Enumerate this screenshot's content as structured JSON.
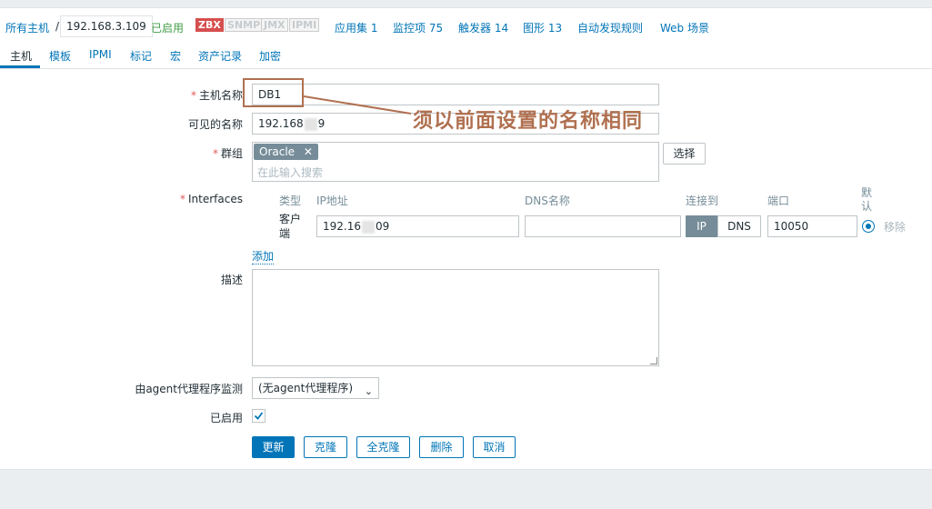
{
  "breadcrumb": {
    "all_hosts": "所有主机",
    "separator": "/",
    "current_host_prefix": "192.168.3.109",
    "status": "已启用",
    "badges": [
      "ZBX",
      "SNMP",
      "JMX",
      "IPMI"
    ],
    "links": [
      "应用集 1",
      "监控项 75",
      "触发器 14",
      "图形 13",
      "自动发现规则",
      "Web 场景"
    ]
  },
  "tabs": [
    "主机",
    "模板",
    "IPMI",
    "标记",
    "宏",
    "资产记录",
    "加密"
  ],
  "form": {
    "host_name_label": "主机名称",
    "host_name_value": "DB1",
    "visible_name_label": "可见的名称",
    "visible_name_prefix": "192.168",
    "visible_name_suffix": "9",
    "groups_label": "群组",
    "group_tag": "Oracle",
    "group_tag_remove": "✕",
    "groups_placeholder": "在此输入搜索",
    "select_button": "选择",
    "interfaces_label": "Interfaces",
    "interfaces_headers": {
      "type": "类型",
      "ip": "IP地址",
      "dns": "DNS名称",
      "connect_to": "连接到",
      "port": "端口",
      "default": "默认"
    },
    "interface_row": {
      "type": "客户端",
      "ip_prefix": "192.16",
      "ip_suffix": "09",
      "dns": "",
      "ip_toggle": "IP",
      "dns_toggle": "DNS",
      "port": "10050",
      "remove": "移除"
    },
    "add_link": "添加",
    "description_label": "描述",
    "proxy_label": "由agent代理程序监测",
    "proxy_value": "(无agent代理程序)",
    "enabled_label": "已启用",
    "enabled_checked": true
  },
  "buttons": {
    "update": "更新",
    "clone": "克隆",
    "full_clone": "全克隆",
    "delete": "删除",
    "cancel": "取消"
  },
  "annotation": {
    "text": "须以前面设置的名称相同",
    "color": "#b07050"
  },
  "colors": {
    "link": "#0275b8",
    "enabled": "#429e47",
    "zbx_badge": "#d64e4e",
    "tag_bg": "#768d99"
  }
}
